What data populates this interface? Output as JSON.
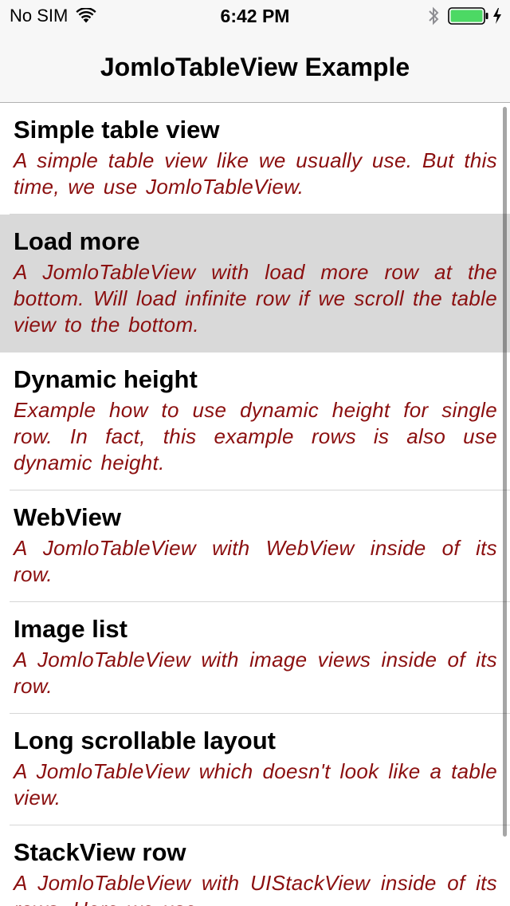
{
  "status_bar": {
    "carrier": "No SIM",
    "time": "6:42 PM",
    "battery_color": "#4cd964"
  },
  "nav": {
    "title": "JomloTableView Example"
  },
  "rows": [
    {
      "title": "Simple table view",
      "description": "A simple table view like we usually use. But this time, we use JomloTableView."
    },
    {
      "title": "Load more",
      "description": "A JomloTableView with load more row at the bottom. Will load infinite row if we scroll the table view to the bottom."
    },
    {
      "title": "Dynamic height",
      "description": "Example how to use dynamic height for single row. In fact, this example rows is also use dynamic height."
    },
    {
      "title": "WebView",
      "description": "A JomloTableView with WebView inside of its row."
    },
    {
      "title": "Image list",
      "description": "A JomloTableView with image views inside of its row."
    },
    {
      "title": "Long scrollable layout",
      "description": "A JomloTableView which doesn't look like a table view."
    },
    {
      "title": "StackView row",
      "description": "A JomloTableView with UIStackView inside of its rows. Here we use"
    }
  ],
  "colors": {
    "description_text": "#8b0f0f",
    "highlight_row": "#d9d9d9",
    "nav_background": "#f7f7f7"
  }
}
